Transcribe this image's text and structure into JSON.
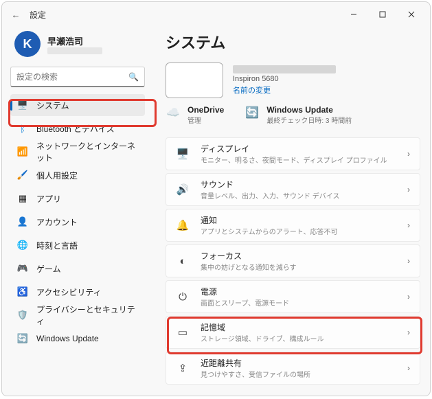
{
  "titlebar": {
    "title": "設定"
  },
  "profile": {
    "name": "早瀬浩司"
  },
  "search": {
    "placeholder": "設定の検索"
  },
  "sidebar": {
    "items": [
      {
        "label": "システム"
      },
      {
        "label": "Bluetooth とデバイス"
      },
      {
        "label": "ネットワークとインターネット"
      },
      {
        "label": "個人用設定"
      },
      {
        "label": "アプリ"
      },
      {
        "label": "アカウント"
      },
      {
        "label": "時刻と言語"
      },
      {
        "label": "ゲーム"
      },
      {
        "label": "アクセシビリティ"
      },
      {
        "label": "プライバシーとセキュリティ"
      },
      {
        "label": "Windows Update"
      }
    ]
  },
  "main": {
    "heading": "システム",
    "device": {
      "model": "Inspiron 5680",
      "rename": "名前の変更"
    },
    "quick": {
      "onedrive": {
        "title": "OneDrive",
        "sub": "管理"
      },
      "update": {
        "title": "Windows Update",
        "sub": "最終チェック日時: 3 時間前"
      }
    },
    "cards": [
      {
        "title": "ディスプレイ",
        "sub": "モニター、明るさ、夜間モード、ディスプレイ プロファイル"
      },
      {
        "title": "サウンド",
        "sub": "音量レベル、出力、入力、サウンド デバイス"
      },
      {
        "title": "通知",
        "sub": "アプリとシステムからのアラート、応答不可"
      },
      {
        "title": "フォーカス",
        "sub": "集中の妨げとなる通知を減らす"
      },
      {
        "title": "電源",
        "sub": "画面とスリープ、電源モード"
      },
      {
        "title": "記憶域",
        "sub": "ストレージ領域、ドライブ、構成ルール"
      },
      {
        "title": "近距離共有",
        "sub": "見つけやすさ、受信ファイルの場所"
      }
    ]
  }
}
